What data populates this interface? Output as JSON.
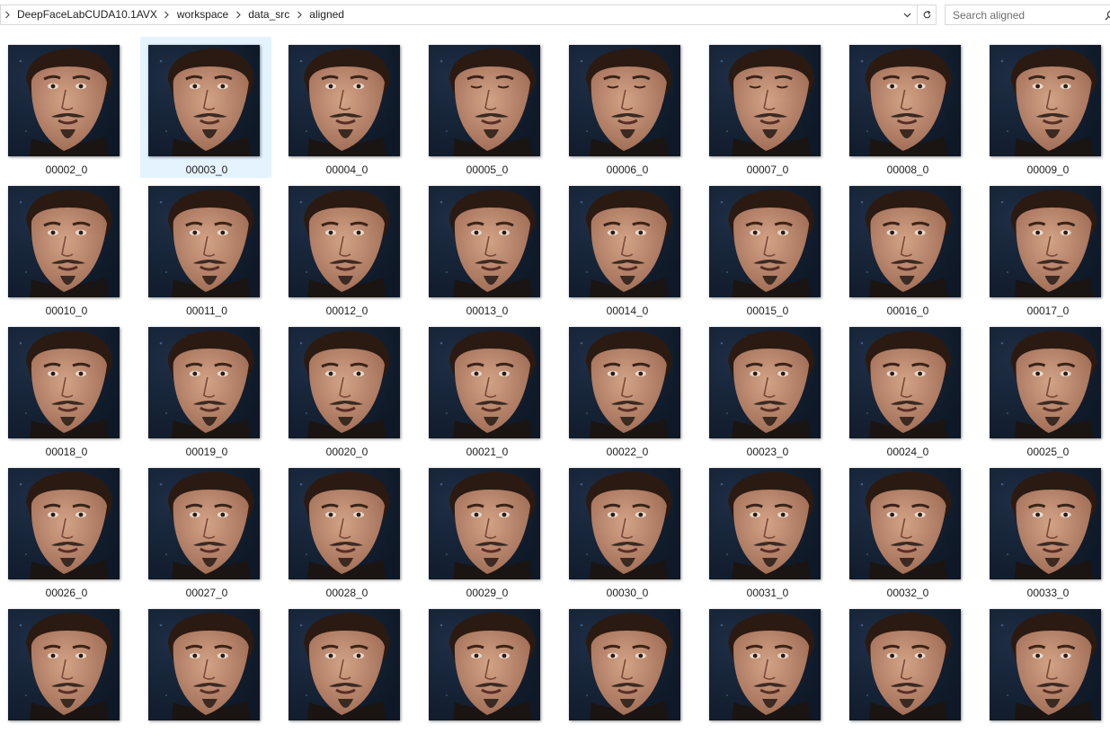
{
  "address_bar": {
    "breadcrumbs": [
      "DeepFaceLabCUDA10.1AVX",
      "workspace",
      "data_src",
      "aligned"
    ]
  },
  "search": {
    "placeholder": "Search aligned",
    "value": ""
  },
  "files": [
    "00002_0",
    "00003_0",
    "00004_0",
    "00005_0",
    "00006_0",
    "00007_0",
    "00008_0",
    "00009_0",
    "00010_0",
    "00011_0",
    "00012_0",
    "00013_0",
    "00014_0",
    "00015_0",
    "00016_0",
    "00017_0",
    "00018_0",
    "00019_0",
    "00020_0",
    "00021_0",
    "00022_0",
    "00023_0",
    "00024_0",
    "00025_0",
    "00026_0",
    "00027_0",
    "00028_0",
    "00029_0",
    "00030_0",
    "00031_0",
    "00032_0",
    "00033_0",
    "",
    "",
    "",
    "",
    "",
    "",
    "",
    ""
  ],
  "selected_file": "00003_0",
  "colors": {
    "selection": "#e5f3ff",
    "thumb_background": "#0e1826",
    "skin": "#c08c70",
    "hair": "#2b1a12",
    "beard": "#3a2a22"
  }
}
